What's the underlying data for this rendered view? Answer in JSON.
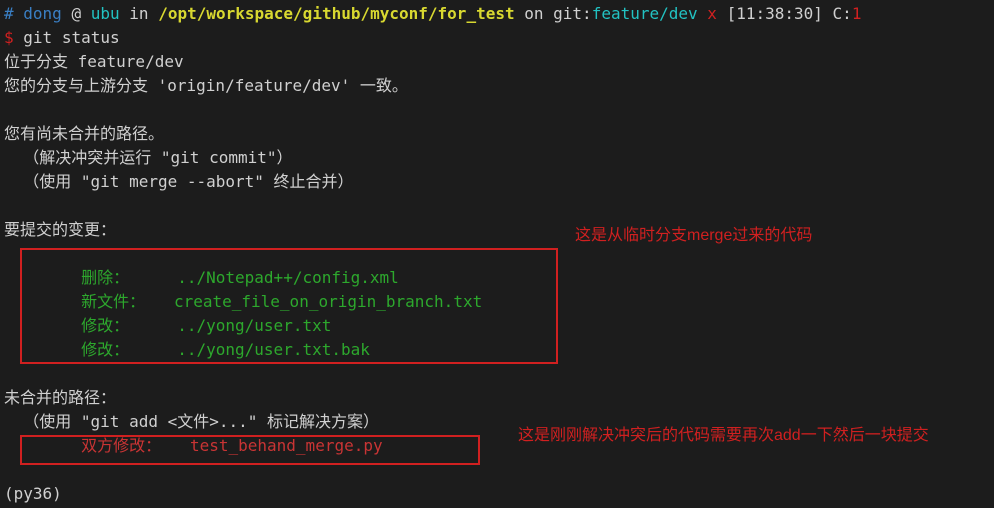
{
  "prompt": {
    "hash": "#",
    "user": "dong",
    "at": "@",
    "host": "ubu",
    "in": "in",
    "path": "/opt/workspace/github/myconf/for_test",
    "on": "on",
    "git": "git:",
    "branch": "feature/dev",
    "x": "x",
    "time": "[11:38:30]",
    "c": "C:",
    "cval": "1",
    "dollar": "$",
    "cmd": "git status"
  },
  "output": {
    "l1": "位于分支 feature/dev",
    "l2": "您的分支与上游分支 'origin/feature/dev' 一致。",
    "l3": "您有尚未合并的路径。",
    "l4": "  （解决冲突并运行 \"git commit\"）",
    "l5": "  （使用 \"git merge --abort\" 终止合并）",
    "l6": "要提交的变更：",
    "staged": {
      "l1": "        删除：     ../Notepad++/config.xml",
      "l2": "        新文件：   create_file_on_origin_branch.txt",
      "l3": "        修改：     ../yong/user.txt",
      "l4": "        修改：     ../yong/user.txt.bak"
    },
    "l7": "未合并的路径：",
    "l8": "  （使用 \"git add <文件>...\" 标记解决方案）",
    "unmerged": {
      "l1": "        双方修改：   test_behand_merge.py"
    },
    "venv": "(py36)"
  },
  "annotations": {
    "a1": "这是从临时分支merge过来的代码",
    "a2": "这是刚刚解决冲突后的代码需要再次add一下然后一块提交"
  }
}
